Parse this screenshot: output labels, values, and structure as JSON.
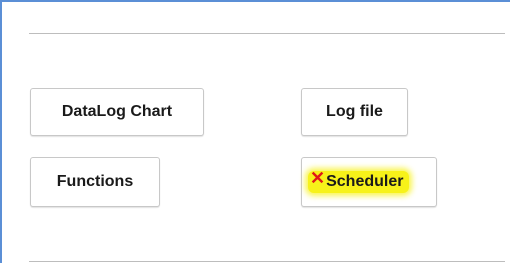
{
  "buttons": {
    "datalog_chart": "DataLog Chart",
    "log_file": "Log file",
    "functions": "Functions",
    "scheduler": "Scheduler"
  },
  "icons": {
    "scheduler_status_icon": "close-icon",
    "scheduler_status_glyph": "✕"
  },
  "colors": {
    "frame_border": "#5b8fd6",
    "highlight": "#f7f21a",
    "error_mark": "#e01818"
  }
}
